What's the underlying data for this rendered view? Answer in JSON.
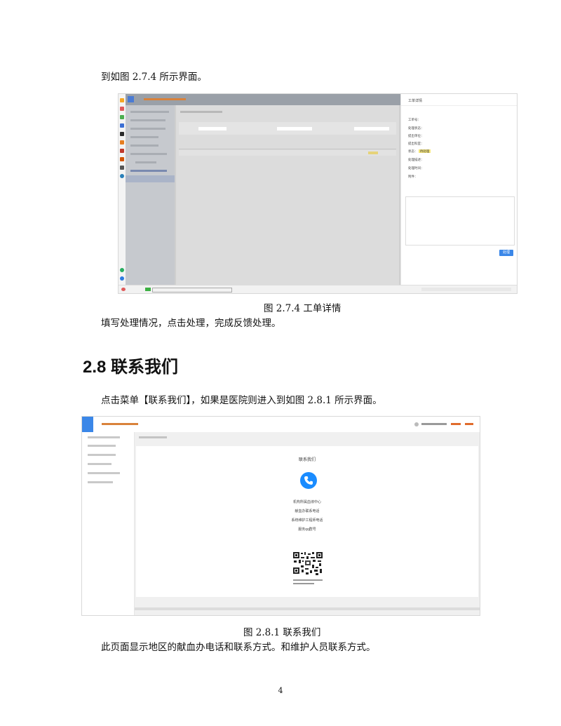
{
  "doc": {
    "intro_line": "到如图 2.7.4 所示界面。",
    "fig1_caption": "图 2.7.4 工单详情",
    "fig1_followup": "填写处理情况，点击处理，完成反馈处理。",
    "section_heading": "2.8 联系我们",
    "section_intro": "点击菜单【联系我们】，如果是医院则进入到如图 2.8.1 所示界面。",
    "fig2_caption": "图 2.8.1 联系我们",
    "fig2_followup": "此页面显示地区的献血办电话和联系方式。和维护人员联系方式。",
    "page_number": "4"
  },
  "fig1": {
    "panel_title": "工单详情",
    "panel_fields": [
      "工单号：",
      "处理状态：",
      "提出单位：",
      "提出科室：",
      "状态：",
      "处理描述：",
      "处理时间：",
      "附件："
    ],
    "status_badge": "待处理",
    "process_button": "处理"
  },
  "fig2": {
    "page_title": "联系我们",
    "lines": [
      "机构所属血液中心",
      "献血办联系电话",
      "系统维护工程师电话",
      "服务qq群号"
    ]
  }
}
